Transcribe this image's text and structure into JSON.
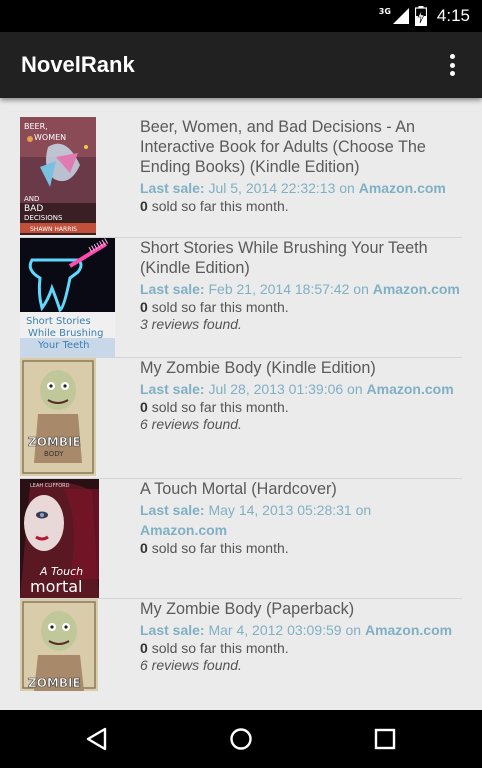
{
  "status_bar": {
    "network": "3G",
    "time": "4:15"
  },
  "app_bar": {
    "title": "NovelRank"
  },
  "books": [
    {
      "title": "Beer, Women, and Bad Decisions - An Interactive Book for Adults (Choose The Ending Books) (Kindle Edition)",
      "last_sale_label": "Last sale:",
      "last_sale_date": "Jul 5, 2014 22:32:13",
      "on_text": "on",
      "store": "Amazon.com",
      "sold_count": "0",
      "sold_text": "sold so far this month.",
      "reviews": "",
      "cover_texts": [
        "BEER,",
        "WOMEN",
        "AND",
        "BAD",
        "DECISIONS",
        "SHAWN HARRIS"
      ]
    },
    {
      "title": "Short Stories While Brushing Your Teeth (Kindle Edition)",
      "last_sale_label": "Last sale:",
      "last_sale_date": "Feb 21, 2014 18:57:42",
      "on_text": "on",
      "store": "Amazon.com",
      "sold_count": "0",
      "sold_text": "sold so far this month.",
      "reviews": "3 reviews found.",
      "cover_texts": [
        "Short Stories",
        "While Brushing",
        "Your Teeth"
      ]
    },
    {
      "title": "My Zombie Body (Kindle Edition)",
      "last_sale_label": "Last sale:",
      "last_sale_date": "Jul 28, 2013 01:39:06",
      "on_text": "on",
      "store": "Amazon.com",
      "sold_count": "0",
      "sold_text": "sold so far this month.",
      "reviews": "6 reviews found.",
      "cover_texts": [
        "ZOMBIE",
        "BODY"
      ]
    },
    {
      "title": "A Touch Mortal (Hardcover)",
      "last_sale_label": "Last sale:",
      "last_sale_date": "May 14, 2013 05:28:31",
      "on_text": "on",
      "store": "Amazon.com",
      "sold_count": "0",
      "sold_text": "sold so far this month.",
      "reviews": "",
      "cover_texts": [
        "LEAH CLIFFORD",
        "A Touch",
        "mortal"
      ]
    },
    {
      "title": "My Zombie Body (Paperback)",
      "last_sale_label": "Last sale:",
      "last_sale_date": "Mar 4, 2012 03:09:59",
      "on_text": "on",
      "store": "Amazon.com",
      "sold_count": "0",
      "sold_text": "sold so far this month.",
      "reviews": "6 reviews found.",
      "cover_texts": [
        "ZOMBIE"
      ]
    }
  ],
  "icons": {
    "network": "signal-3g-icon",
    "battery": "battery-charging-icon",
    "overflow": "overflow-menu-icon",
    "back": "back-nav-icon",
    "home": "home-nav-icon",
    "recents": "recents-nav-icon"
  },
  "colors": {
    "app_bar": "#212121",
    "background": "#ebebeb",
    "title_text": "#5a5a5a",
    "link": "#7fb0c4"
  }
}
